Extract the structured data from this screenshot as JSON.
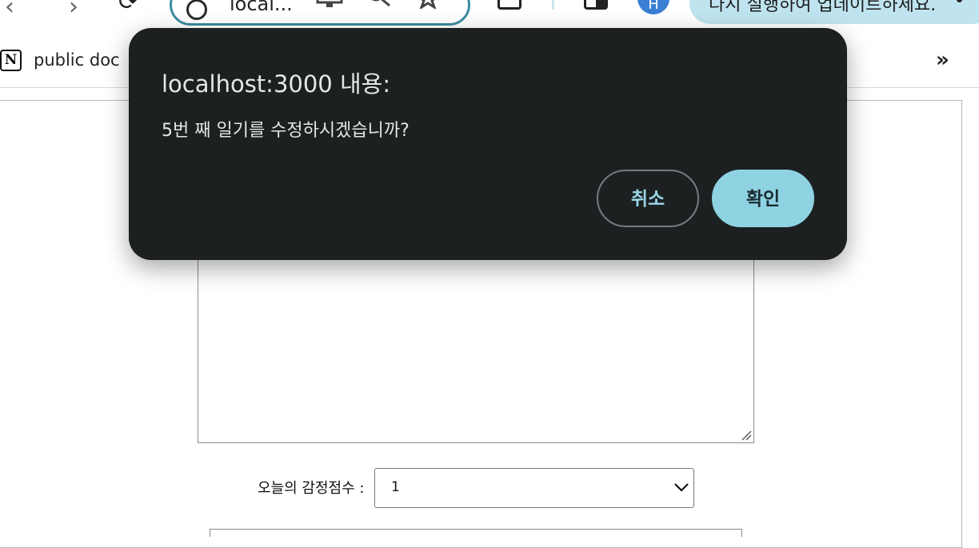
{
  "browser": {
    "url_text": "local...",
    "profile_initial": "H",
    "update_text": "다시 실행하여 업데이트하세요.",
    "back_glyph": "‹",
    "forward_glyph": "›",
    "reload_glyph": "⟳",
    "icons": [
      "back-icon",
      "forward-icon",
      "reload-icon",
      "site-info-icon",
      "cast-icon",
      "search-icon",
      "star-icon",
      "share-icon",
      "split-view-icon",
      "profile-avatar",
      "menu-icon"
    ]
  },
  "bookmarks": {
    "first_label": "public doc",
    "notion_letter": "N",
    "overflow_glyph": "»"
  },
  "page": {
    "emotion_label": "오늘의 감정점수 :",
    "emotion_value": "1"
  },
  "dialog": {
    "title": "localhost:3000 내용:",
    "message": "5번 째 일기를 수정하시겠습니까?",
    "cancel_label": "취소",
    "ok_label": "확인"
  },
  "colors": {
    "dialog_bg": "#1c2021",
    "ok_button": "#8fd3e3",
    "cancel_text": "#99d6e6",
    "omnibox_border": "#3b8ca1",
    "update_pill": "#bfe4ef",
    "profile": "#3b7fd4"
  }
}
